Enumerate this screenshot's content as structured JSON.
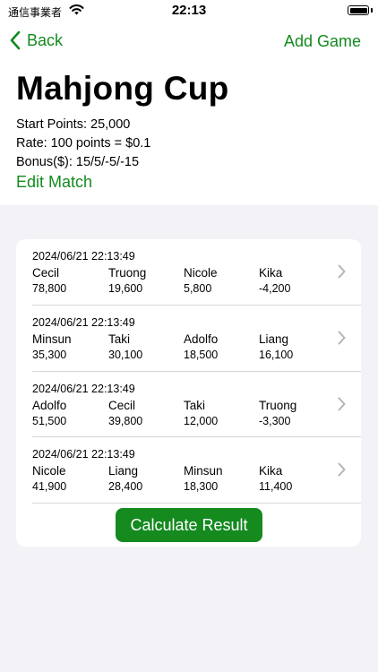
{
  "status": {
    "carrier": "通信事業者",
    "time": "22:13"
  },
  "nav": {
    "back_label": "Back",
    "add_label": "Add Game"
  },
  "match": {
    "title": "Mahjong Cup",
    "start_points": "Start Points: 25,000",
    "rate": "Rate: 100 points = $0.1",
    "bonus": "Bonus($): 15/5/-5/-15",
    "edit_label": "Edit Match"
  },
  "games": [
    {
      "timestamp": "2024/06/21 22:13:49",
      "players": [
        {
          "name": "Cecil",
          "points": "78,800"
        },
        {
          "name": "Truong",
          "points": "19,600"
        },
        {
          "name": "Nicole",
          "points": "5,800"
        },
        {
          "name": "Kika",
          "points": "-4,200"
        }
      ]
    },
    {
      "timestamp": "2024/06/21 22:13:49",
      "players": [
        {
          "name": "Minsun",
          "points": "35,300"
        },
        {
          "name": "Taki",
          "points": "30,100"
        },
        {
          "name": "Adolfo",
          "points": "18,500"
        },
        {
          "name": "Liang",
          "points": "16,100"
        }
      ]
    },
    {
      "timestamp": "2024/06/21 22:13:49",
      "players": [
        {
          "name": "Adolfo",
          "points": "51,500"
        },
        {
          "name": "Cecil",
          "points": "39,800"
        },
        {
          "name": "Taki",
          "points": "12,000"
        },
        {
          "name": "Truong",
          "points": "-3,300"
        }
      ]
    },
    {
      "timestamp": "2024/06/21 22:13:49",
      "players": [
        {
          "name": "Nicole",
          "points": "41,900"
        },
        {
          "name": "Liang",
          "points": "28,400"
        },
        {
          "name": "Minsun",
          "points": "18,300"
        },
        {
          "name": "Kika",
          "points": "11,400"
        }
      ]
    }
  ],
  "calculate_label": "Calculate Result",
  "colors": {
    "accent": "#148a1f",
    "background": "#f2f2f7"
  }
}
